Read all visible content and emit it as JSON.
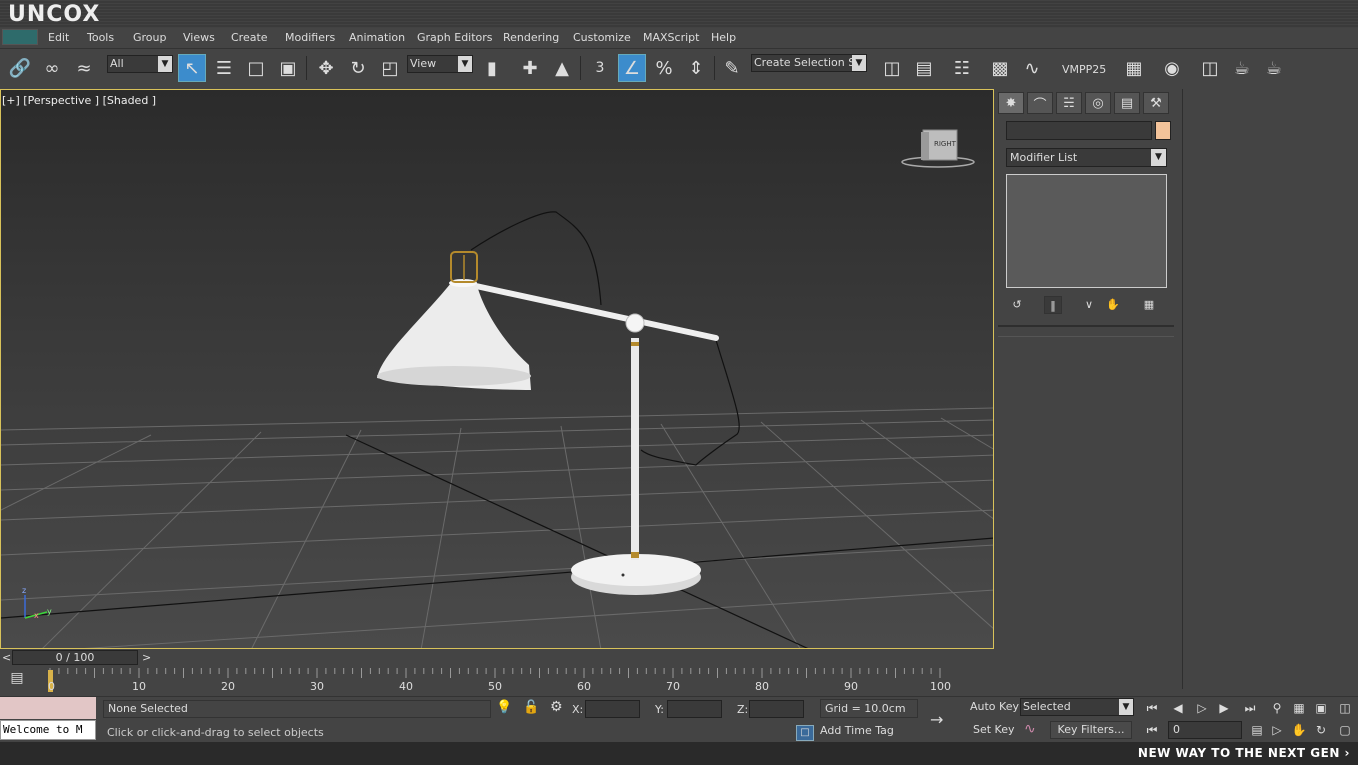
{
  "brand": "UNCOX",
  "menu": {
    "items": [
      "Edit",
      "Tools",
      "Group",
      "Views",
      "Create",
      "Modifiers",
      "Animation",
      "Graph Editors",
      "Rendering",
      "Customize",
      "MAXScript",
      "Help"
    ]
  },
  "toolbar": {
    "selection_filter": "All",
    "ref_coord": "View",
    "snap_label": "3",
    "named_selection": "Create Selection Se",
    "vmpp_label": "VMPP25"
  },
  "viewport": {
    "label": "[+] [Perspective ] [Shaded ]",
    "viewcube_label": "RIGHT",
    "axis_z": "z",
    "axis_x": "x",
    "axis_y": "y"
  },
  "command_panel": {
    "modifier_list": "Modifier List",
    "color_swatch": "#f3c39a"
  },
  "timeline": {
    "slider_label": "0 / 100",
    "prev": "<",
    "next": ">",
    "ticks": [
      "0",
      "10",
      "20",
      "30",
      "40",
      "50",
      "60",
      "70",
      "80",
      "90",
      "100"
    ]
  },
  "status": {
    "maxscript_text": "Welcome to M",
    "selection": "None Selected",
    "prompt": "Click or click-and-drag to select objects",
    "x_label": "X:",
    "y_label": "Y:",
    "z_label": "Z:",
    "grid": "Grid = 10.0cm",
    "add_time_tag": "Add Time Tag",
    "auto_key": "Auto Key",
    "set_key": "Set Key",
    "key_mode": "Selected",
    "key_filters": "Key Filters...",
    "frame": "0"
  },
  "banner": "NEW WAY TO THE NEXT GEN ›",
  "colors": {
    "viewport_border": "#d8c25a",
    "active_tool": "#3c8ccc",
    "maxscript_listener": "#e2c6c6"
  }
}
